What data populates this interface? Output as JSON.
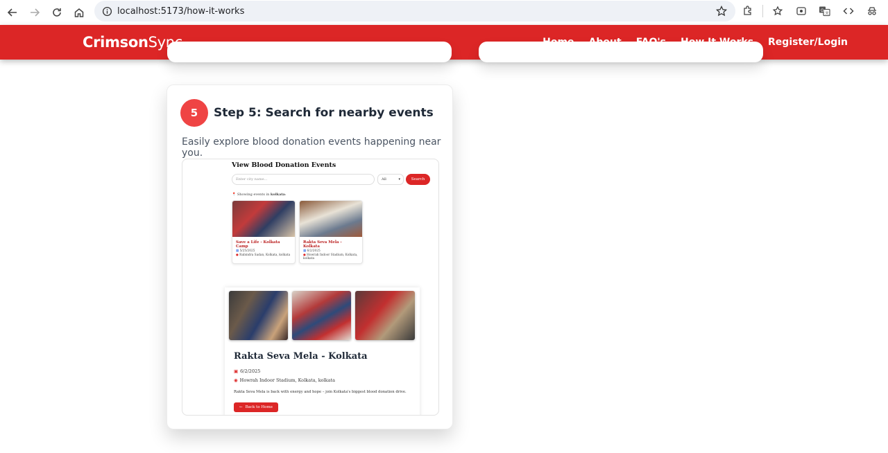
{
  "browser": {
    "url": "localhost:5173/how-it-works"
  },
  "site": {
    "brand_bold": "Crimson",
    "brand_light": "Sync",
    "menu": [
      "Home",
      "About",
      "FAQ's",
      "How It Works",
      "Register/Login"
    ]
  },
  "step": {
    "number": "5",
    "title": "Step 5: Search for nearby events",
    "description": "Easily explore blood donation events happening near you."
  },
  "screenshot": {
    "heading": "View Blood Donation Events",
    "search_placeholder": "Enter city name...",
    "filter_value": "All",
    "search_button": "Search",
    "showing_prefix": "Showing events in ",
    "showing_city": "kolkata",
    "showing_suffix": ":",
    "events": [
      {
        "name": "Save a Life - Kolkata Camp",
        "date": "5/25/2025",
        "location": "Rabindra Sadan, Kolkata, kolkata"
      },
      {
        "name": "Rakta Seva Mela - Kolkata",
        "date": "6/2/2025",
        "location": "Howrah Indoor Stadium, Kolkata, kolkata"
      }
    ],
    "detail": {
      "title": "Rakta Seva Mela - Kolkata",
      "date": "6/2/2025",
      "location": "Howrah Indoor Stadium, Kolkata, kolkata",
      "text": "Rakta Seva Mela is back with energy and hope – join Kolkata's biggest blood donation drive.",
      "back_button": "Back to Home"
    }
  },
  "colors": {
    "brand_red": "#dc2626",
    "badge_red": "#ef4444"
  }
}
